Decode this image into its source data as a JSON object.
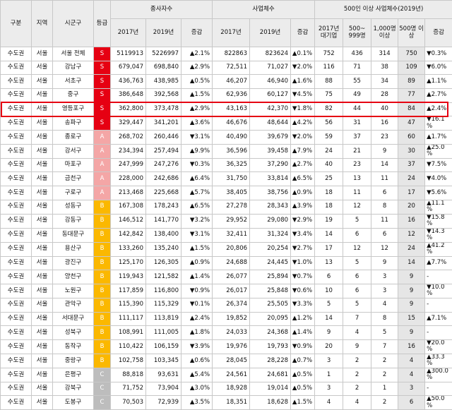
{
  "headers": {
    "gubun": "구분",
    "region": "지역",
    "district": "시군구",
    "grade": "등급",
    "employees": "종사자수",
    "businesses": "사업체수",
    "large": "500인 이상 사업체수(2019년)",
    "y2017": "2017년",
    "y2019": "2019년",
    "change": "증감",
    "large_2017": "2017년 대기업",
    "large_500_999": "500~ 999명",
    "large_1000": "1,000명 이상",
    "large_500plus": "500명 이상",
    "large_change": "증감"
  },
  "rows": [
    {
      "gubun": "수도권",
      "region": "서울",
      "district": "서울 전체",
      "grade": "S",
      "emp2017": "5119913",
      "emp2019": "5226997",
      "empChg": "▲2.1%",
      "biz2017": "822863",
      "biz2019": "823624",
      "bizChg": "▲0.1%",
      "l2017": "752",
      "l500": "436",
      "l1000": "314",
      "l500p": "750",
      "lChg": "▼0.3%"
    },
    {
      "gubun": "수도권",
      "region": "서울",
      "district": "강남구",
      "grade": "S",
      "emp2017": "679,047",
      "emp2019": "698,840",
      "empChg": "▲2.9%",
      "biz2017": "72,511",
      "biz2019": "71,027",
      "bizChg": "▼2.0%",
      "l2017": "116",
      "l500": "71",
      "l1000": "38",
      "l500p": "109",
      "lChg": "▼6.0%"
    },
    {
      "gubun": "수도권",
      "region": "서울",
      "district": "서초구",
      "grade": "S",
      "emp2017": "436,763",
      "emp2019": "438,985",
      "empChg": "▲0.5%",
      "biz2017": "46,207",
      "biz2019": "46,940",
      "bizChg": "▲1.6%",
      "l2017": "88",
      "l500": "55",
      "l1000": "34",
      "l500p": "89",
      "lChg": "▲1.1%"
    },
    {
      "gubun": "수도권",
      "region": "서울",
      "district": "중구",
      "grade": "S",
      "emp2017": "386,648",
      "emp2019": "392,568",
      "empChg": "▲1.5%",
      "biz2017": "62,936",
      "biz2019": "60,127",
      "bizChg": "▼4.5%",
      "l2017": "75",
      "l500": "49",
      "l1000": "28",
      "l500p": "77",
      "lChg": "▲2.7%"
    },
    {
      "gubun": "수도권",
      "region": "서울",
      "district": "영등포구",
      "grade": "S",
      "emp2017": "362,800",
      "emp2019": "373,478",
      "empChg": "▲2.9%",
      "biz2017": "43,163",
      "biz2019": "42,370",
      "bizChg": "▼1.8%",
      "l2017": "82",
      "l500": "44",
      "l1000": "40",
      "l500p": "84",
      "lChg": "▲2.4%"
    },
    {
      "gubun": "수도권",
      "region": "서울",
      "district": "송파구",
      "grade": "S",
      "emp2017": "329,447",
      "emp2019": "341,201",
      "empChg": "▲3.6%",
      "biz2017": "46,676",
      "biz2019": "48,644",
      "bizChg": "▲4.2%",
      "l2017": "56",
      "l500": "31",
      "l1000": "16",
      "l500p": "47",
      "lChg": "▼16.1 %"
    },
    {
      "gubun": "수도권",
      "region": "서울",
      "district": "종로구",
      "grade": "A",
      "emp2017": "268,702",
      "emp2019": "260,446",
      "empChg": "▼3.1%",
      "biz2017": "40,490",
      "biz2019": "39,679",
      "bizChg": "▼2.0%",
      "l2017": "59",
      "l500": "37",
      "l1000": "23",
      "l500p": "60",
      "lChg": "▲1.7%"
    },
    {
      "gubun": "수도권",
      "region": "서울",
      "district": "강서구",
      "grade": "A",
      "emp2017": "234,394",
      "emp2019": "257,494",
      "empChg": "▲9.9%",
      "biz2017": "36,596",
      "biz2019": "39,458",
      "bizChg": "▲7.9%",
      "l2017": "24",
      "l500": "21",
      "l1000": "9",
      "l500p": "30",
      "lChg": "▲25.0 %"
    },
    {
      "gubun": "수도권",
      "region": "서울",
      "district": "마포구",
      "grade": "A",
      "emp2017": "247,999",
      "emp2019": "247,276",
      "empChg": "▼0.3%",
      "biz2017": "36,325",
      "biz2019": "37,290",
      "bizChg": "▲2.7%",
      "l2017": "40",
      "l500": "23",
      "l1000": "14",
      "l500p": "37",
      "lChg": "▼7.5%"
    },
    {
      "gubun": "수도권",
      "region": "서울",
      "district": "금천구",
      "grade": "A",
      "emp2017": "228,000",
      "emp2019": "242,686",
      "empChg": "▲6.4%",
      "biz2017": "31,750",
      "biz2019": "33,814",
      "bizChg": "▲6.5%",
      "l2017": "25",
      "l500": "13",
      "l1000": "11",
      "l500p": "24",
      "lChg": "▼4.0%"
    },
    {
      "gubun": "수도권",
      "region": "서울",
      "district": "구로구",
      "grade": "A",
      "emp2017": "213,468",
      "emp2019": "225,668",
      "empChg": "▲5.7%",
      "biz2017": "38,405",
      "biz2019": "38,756",
      "bizChg": "▲0.9%",
      "l2017": "18",
      "l500": "11",
      "l1000": "6",
      "l500p": "17",
      "lChg": "▼5.6%"
    },
    {
      "gubun": "수도권",
      "region": "서울",
      "district": "성동구",
      "grade": "B",
      "emp2017": "167,308",
      "emp2019": "178,243",
      "empChg": "▲6.5%",
      "biz2017": "27,278",
      "biz2019": "28,343",
      "bizChg": "▲3.9%",
      "l2017": "18",
      "l500": "12",
      "l1000": "8",
      "l500p": "20",
      "lChg": "▲11.1 %"
    },
    {
      "gubun": "수도권",
      "region": "서울",
      "district": "강동구",
      "grade": "B",
      "emp2017": "146,512",
      "emp2019": "141,770",
      "empChg": "▼3.2%",
      "biz2017": "29,952",
      "biz2019": "29,080",
      "bizChg": "▼2.9%",
      "l2017": "19",
      "l500": "5",
      "l1000": "11",
      "l500p": "16",
      "lChg": "▼15.8 %"
    },
    {
      "gubun": "수도권",
      "region": "서울",
      "district": "동대문구",
      "grade": "B",
      "emp2017": "142,842",
      "emp2019": "138,400",
      "empChg": "▼3.1%",
      "biz2017": "32,411",
      "biz2019": "31,324",
      "bizChg": "▼3.4%",
      "l2017": "14",
      "l500": "6",
      "l1000": "6",
      "l500p": "12",
      "lChg": "▼14.3 %"
    },
    {
      "gubun": "수도권",
      "region": "서울",
      "district": "용산구",
      "grade": "B",
      "emp2017": "133,260",
      "emp2019": "135,240",
      "empChg": "▲1.5%",
      "biz2017": "20,806",
      "biz2019": "20,254",
      "bizChg": "▼2.7%",
      "l2017": "17",
      "l500": "12",
      "l1000": "12",
      "l500p": "24",
      "lChg": "▲41.2 %"
    },
    {
      "gubun": "수도권",
      "region": "서울",
      "district": "광진구",
      "grade": "B",
      "emp2017": "125,170",
      "emp2019": "126,305",
      "empChg": "▲0.9%",
      "biz2017": "24,688",
      "biz2019": "24,445",
      "bizChg": "▼1.0%",
      "l2017": "13",
      "l500": "5",
      "l1000": "9",
      "l500p": "14",
      "lChg": "▲7.7%"
    },
    {
      "gubun": "수도권",
      "region": "서울",
      "district": "양천구",
      "grade": "B",
      "emp2017": "119,943",
      "emp2019": "121,582",
      "empChg": "▲1.4%",
      "biz2017": "26,077",
      "biz2019": "25,894",
      "bizChg": "▼0.7%",
      "l2017": "6",
      "l500": "6",
      "l1000": "3",
      "l500p": "9",
      "lChg": "-"
    },
    {
      "gubun": "수도권",
      "region": "서울",
      "district": "노원구",
      "grade": "B",
      "emp2017": "117,859",
      "emp2019": "116,800",
      "empChg": "▼0.9%",
      "biz2017": "26,017",
      "biz2019": "25,848",
      "bizChg": "▼0.6%",
      "l2017": "10",
      "l500": "6",
      "l1000": "3",
      "l500p": "9",
      "lChg": "▼10.0 %"
    },
    {
      "gubun": "수도권",
      "region": "서울",
      "district": "관악구",
      "grade": "B",
      "emp2017": "115,390",
      "emp2019": "115,329",
      "empChg": "▼0.1%",
      "biz2017": "26,374",
      "biz2019": "25,505",
      "bizChg": "▼3.3%",
      "l2017": "5",
      "l500": "5",
      "l1000": "4",
      "l500p": "9",
      "lChg": "-"
    },
    {
      "gubun": "수도권",
      "region": "서울",
      "district": "서대문구",
      "grade": "B",
      "emp2017": "111,117",
      "emp2019": "113,819",
      "empChg": "▲2.4%",
      "biz2017": "19,852",
      "biz2019": "20,095",
      "bizChg": "▲1.2%",
      "l2017": "14",
      "l500": "7",
      "l1000": "8",
      "l500p": "15",
      "lChg": "▲7.1%"
    },
    {
      "gubun": "수도권",
      "region": "서울",
      "district": "성북구",
      "grade": "B",
      "emp2017": "108,991",
      "emp2019": "111,005",
      "empChg": "▲1.8%",
      "biz2017": "24,033",
      "biz2019": "24,368",
      "bizChg": "▲1.4%",
      "l2017": "9",
      "l500": "4",
      "l1000": "5",
      "l500p": "9",
      "lChg": "-"
    },
    {
      "gubun": "수도권",
      "region": "서울",
      "district": "동작구",
      "grade": "B",
      "emp2017": "110,422",
      "emp2019": "106,159",
      "empChg": "▼3.9%",
      "biz2017": "19,976",
      "biz2019": "19,793",
      "bizChg": "▼0.9%",
      "l2017": "20",
      "l500": "9",
      "l1000": "7",
      "l500p": "16",
      "lChg": "▼20.0 %"
    },
    {
      "gubun": "수도권",
      "region": "서울",
      "district": "중랑구",
      "grade": "B",
      "emp2017": "102,758",
      "emp2019": "103,345",
      "empChg": "▲0.6%",
      "biz2017": "28,045",
      "biz2019": "28,228",
      "bizChg": "▲0.7%",
      "l2017": "3",
      "l500": "2",
      "l1000": "2",
      "l500p": "4",
      "lChg": "▲33.3 %"
    },
    {
      "gubun": "수도권",
      "region": "서울",
      "district": "은평구",
      "grade": "C",
      "emp2017": "88,818",
      "emp2019": "93,631",
      "empChg": "▲5.4%",
      "biz2017": "24,561",
      "biz2019": "24,681",
      "bizChg": "▲0.5%",
      "l2017": "1",
      "l500": "2",
      "l1000": "2",
      "l500p": "4",
      "lChg": "▲300.0 %"
    },
    {
      "gubun": "수도권",
      "region": "서울",
      "district": "강북구",
      "grade": "C",
      "emp2017": "71,752",
      "emp2019": "73,904",
      "empChg": "▲3.0%",
      "biz2017": "18,928",
      "biz2019": "19,014",
      "bizChg": "▲0.5%",
      "l2017": "3",
      "l500": "2",
      "l1000": "1",
      "l500p": "3",
      "lChg": "-"
    },
    {
      "gubun": "수도권",
      "region": "서울",
      "district": "도봉구",
      "grade": "C",
      "emp2017": "70,503",
      "emp2019": "72,939",
      "empChg": "▲3.5%",
      "biz2017": "18,351",
      "biz2019": "18,628",
      "bizChg": "▲1.5%",
      "l2017": "4",
      "l500": "4",
      "l1000": "2",
      "l500p": "6",
      "lChg": "▲50.0 %"
    }
  ],
  "highlight_district": "영등포구",
  "grade_colors": {
    "S": "#e60012",
    "A": "#f4a6a6",
    "B": "#fbb800",
    "C": "#bdbdbd"
  }
}
